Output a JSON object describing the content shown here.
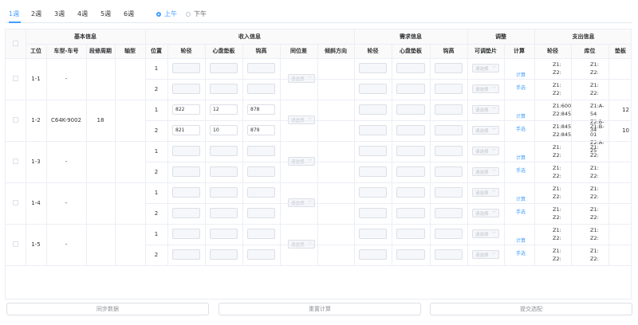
{
  "weeks": [
    "1週",
    "2週",
    "3週",
    "4週",
    "5週",
    "6週"
  ],
  "shift": {
    "am": "上午",
    "pm": "下午",
    "selected": "am"
  },
  "groups": {
    "basic": "基本信息",
    "income": "收入信息",
    "demand": "需求信息",
    "adjust": "调整",
    "output": "支出信息"
  },
  "columns": {
    "station": "工位",
    "model_no": "车型-车号",
    "cycle": "段修周期",
    "axle_type": "轴型",
    "position": "位置",
    "wheel_dia": "轮径",
    "plate_pad": "心盘垫板",
    "coupler_h": "钩高",
    "pos_diff": "同位差",
    "tilt": "倾斜方向",
    "d_wheel_dia": "轮径",
    "d_plate_pad": "心盘垫板",
    "d_coupler_h": "钩高",
    "adj_pad": "可调垫片",
    "calc": "计算",
    "o_wheel_dia": "轮径",
    "o_location": "库位",
    "o_pad": "垫板"
  },
  "labels": {
    "select_placeholder": "请选择",
    "calc": "计算",
    "manual": "手选"
  },
  "stations": [
    {
      "station": "1-1",
      "model_no": "-",
      "cycle": "",
      "rows": [
        {
          "pos": "1",
          "wheel": "",
          "pad": "",
          "hook": "",
          "o_wheel_1": "Z1:",
          "o_wheel_2": "Z2:",
          "o_loc_1": "Z1:",
          "o_loc_2": "Z2:",
          "o_pad": ""
        },
        {
          "pos": "2",
          "wheel": "",
          "pad": "",
          "hook": "",
          "o_wheel_1": "Z1:",
          "o_wheel_2": "Z2:",
          "o_loc_1": "Z1:",
          "o_loc_2": "Z2:",
          "o_pad": ""
        }
      ]
    },
    {
      "station": "1-2",
      "model_no": "C64K-9002",
      "cycle": "18",
      "rows": [
        {
          "pos": "1",
          "wheel": "822",
          "pad": "12",
          "hook": "878",
          "o_wheel_1": "Z1:600",
          "o_wheel_2": "Z2:845",
          "o_loc_1": "Z1:A-54",
          "o_loc_2": "Z2:B-34",
          "o_pad": "12"
        },
        {
          "pos": "2",
          "wheel": "821",
          "pad": "10",
          "hook": "879",
          "o_wheel_1": "Z1:845",
          "o_wheel_2": "Z2:845",
          "o_loc_1": "Z1:B-01",
          "o_loc_2": "Z2:A-25",
          "o_pad": "10"
        }
      ]
    },
    {
      "station": "1-3",
      "model_no": "-",
      "cycle": "",
      "rows": [
        {
          "pos": "1",
          "wheel": "",
          "pad": "",
          "hook": "",
          "o_wheel_1": "Z1:",
          "o_wheel_2": "Z2:",
          "o_loc_1": "Z1:",
          "o_loc_2": "Z2:",
          "o_pad": ""
        },
        {
          "pos": "2",
          "wheel": "",
          "pad": "",
          "hook": "",
          "o_wheel_1": "Z1:",
          "o_wheel_2": "Z2:",
          "o_loc_1": "Z1:",
          "o_loc_2": "Z2:",
          "o_pad": ""
        }
      ]
    },
    {
      "station": "1-4",
      "model_no": "-",
      "cycle": "",
      "rows": [
        {
          "pos": "1",
          "wheel": "",
          "pad": "",
          "hook": "",
          "o_wheel_1": "Z1:",
          "o_wheel_2": "Z2:",
          "o_loc_1": "Z1:",
          "o_loc_2": "Z2:",
          "o_pad": ""
        },
        {
          "pos": "2",
          "wheel": "",
          "pad": "",
          "hook": "",
          "o_wheel_1": "Z1:",
          "o_wheel_2": "Z2:",
          "o_loc_1": "Z1:",
          "o_loc_2": "Z2:",
          "o_pad": ""
        }
      ]
    },
    {
      "station": "1-5",
      "model_no": "-",
      "cycle": "",
      "rows": [
        {
          "pos": "1",
          "wheel": "",
          "pad": "",
          "hook": "",
          "o_wheel_1": "Z1:",
          "o_wheel_2": "Z2:",
          "o_loc_1": "Z1:",
          "o_loc_2": "Z2:",
          "o_pad": ""
        },
        {
          "pos": "2",
          "wheel": "",
          "pad": "",
          "hook": "",
          "o_wheel_1": "Z1:",
          "o_wheel_2": "Z2:",
          "o_loc_1": "Z1:",
          "o_loc_2": "Z2:",
          "o_pad": ""
        }
      ]
    }
  ],
  "buttons": {
    "sync": "同步数据",
    "recalc": "重置计算",
    "submit": "提交选配"
  },
  "colors": {
    "accent": "#409eff",
    "border": "#ebeef5",
    "input_bg": "#f5f7fa"
  }
}
